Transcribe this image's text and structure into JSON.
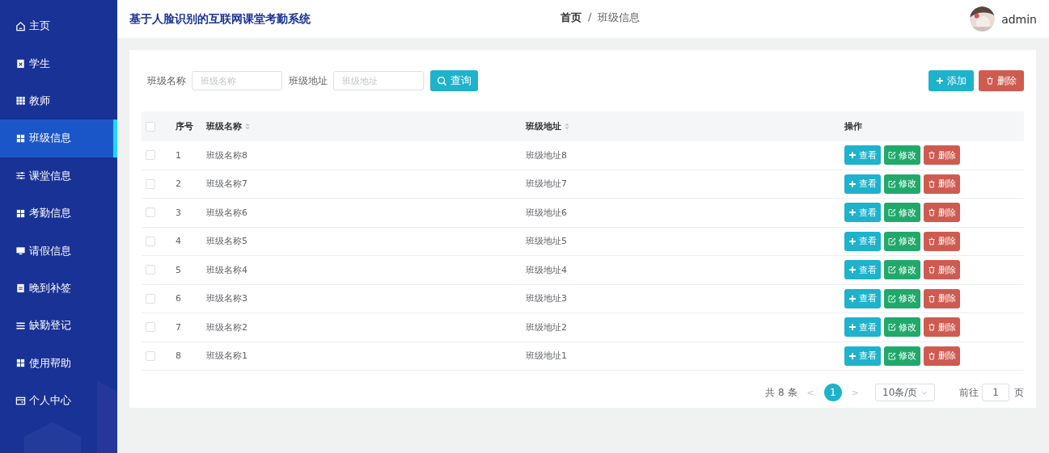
{
  "sidebar": {
    "items": [
      {
        "label": "主页",
        "selected": false
      },
      {
        "label": "学生",
        "selected": false
      },
      {
        "label": "教师",
        "selected": false
      },
      {
        "label": "班级信息",
        "selected": true
      },
      {
        "label": "课堂信息",
        "selected": false
      },
      {
        "label": "考勤信息",
        "selected": false
      },
      {
        "label": "请假信息",
        "selected": false
      },
      {
        "label": "晚到补签",
        "selected": false
      },
      {
        "label": "缺勤登记",
        "selected": false
      },
      {
        "label": "使用帮助",
        "selected": false
      },
      {
        "label": "个人中心",
        "selected": false
      }
    ]
  },
  "header": {
    "title": "基于人脸识别的互联网课堂考勤系统",
    "breadcrumb": [
      "首页",
      "班级信息"
    ],
    "separator": "/",
    "user": "admin"
  },
  "search": {
    "fields": [
      {
        "label": "班级名称",
        "placeholder": "班级名称"
      },
      {
        "label": "班级地址",
        "placeholder": "班级地址"
      }
    ],
    "button": "查询"
  },
  "toolbar": {
    "add": "添加",
    "delete": "删除"
  },
  "table": {
    "columns": [
      "序号",
      "班级名称",
      "班级地址",
      "操作"
    ],
    "all_checked": false,
    "rows": [
      {
        "index": "1",
        "name": "班级名称8",
        "address": "班级地址8",
        "checked": false,
        "actions": [
          "查看",
          "修改",
          "删除"
        ]
      },
      {
        "index": "2",
        "name": "班级名称7",
        "address": "班级地址7",
        "checked": false,
        "actions": [
          "查看",
          "修改",
          "删除"
        ]
      },
      {
        "index": "3",
        "name": "班级名称6",
        "address": "班级地址6",
        "checked": false,
        "actions": [
          "查看",
          "修改",
          "删除"
        ]
      },
      {
        "index": "4",
        "name": "班级名称5",
        "address": "班级地址5",
        "checked": false,
        "actions": [
          "查看",
          "修改",
          "删除"
        ]
      },
      {
        "index": "5",
        "name": "班级名称4",
        "address": "班级地址4",
        "checked": false,
        "actions": [
          "查看",
          "修改",
          "删除"
        ]
      },
      {
        "index": "6",
        "name": "班级名称3",
        "address": "班级地址3",
        "checked": false,
        "actions": [
          "查看",
          "修改",
          "删除"
        ]
      },
      {
        "index": "7",
        "name": "班级名称2",
        "address": "班级地址2",
        "checked": false,
        "actions": [
          "查看",
          "修改",
          "删除"
        ]
      },
      {
        "index": "8",
        "name": "班级名称1",
        "address": "班级地址1",
        "checked": false,
        "actions": [
          "查看",
          "修改",
          "删除"
        ]
      }
    ]
  },
  "pagination": {
    "total": "共 8 条",
    "prev": "<",
    "pages": [
      {
        "label": "1",
        "selected": true
      }
    ],
    "next": ">",
    "page_size": "10条/页",
    "goto_label": "前往",
    "goto_value": "1",
    "goto_suffix": "页"
  }
}
